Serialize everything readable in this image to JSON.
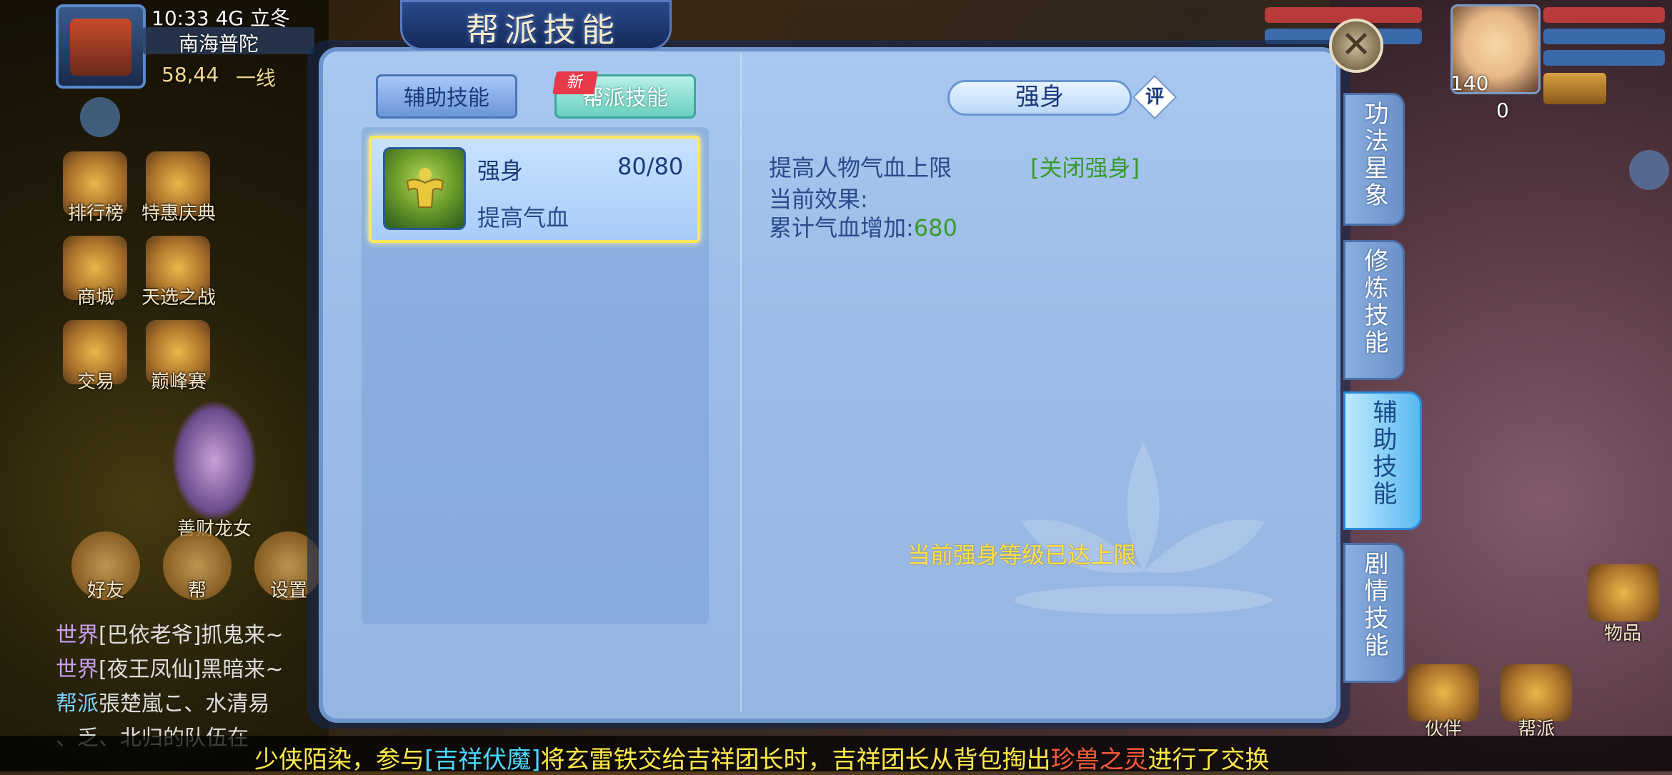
{
  "hud": {
    "time_signal_term": "10:33 4G 立冬",
    "location": "南海普陀",
    "coords": "58,44",
    "line": "一线",
    "right_level": "140",
    "right_count": "0"
  },
  "left_menu": [
    {
      "label": "排行榜",
      "icon": "ranking-icon"
    },
    {
      "label": "特惠庆典",
      "icon": "celebration-icon"
    },
    {
      "label": "商城",
      "icon": "shop-icon"
    },
    {
      "label": "天选之战",
      "icon": "battle-icon"
    },
    {
      "label": "交易",
      "icon": "trade-icon"
    },
    {
      "label": "巅峰赛",
      "icon": "peak-icon"
    }
  ],
  "npc_name": "善财龙女",
  "bottom_buttons": {
    "friends": "好友",
    "guild": "帮",
    "settings": "设置"
  },
  "chat": [
    {
      "channel": "世界",
      "text": "[巴依老爷]抓鬼来~"
    },
    {
      "channel": "世界",
      "text": "[夜王凤仙]黑暗来~"
    },
    {
      "channel": "帮派",
      "text": "張楚嵐こ、水清易"
    },
    {
      "channel": "",
      "text": "、乏、北归的队伍在"
    }
  ],
  "right_hud": {
    "items_label": "物品",
    "partner_label": "伙伴",
    "guild_label": "帮派"
  },
  "panel": {
    "title": "帮派技能",
    "close_icon": "close-icon",
    "tabs": {
      "aux": "辅助技能",
      "guild": "帮派技能",
      "new_badge": "新"
    },
    "skill": {
      "name": "强身",
      "level": "80/80",
      "desc": "提高气血"
    },
    "detail": {
      "title": "强身",
      "eval": "评",
      "line1": "提高人物气血上限",
      "line2": "当前效果:",
      "line3_label": "累计气血增加:",
      "line3_value": "680",
      "toggle": "[关闭强身]",
      "status": "当前强身等级已达上限"
    },
    "side_tabs": [
      {
        "label": "功法星象",
        "active": false
      },
      {
        "label": "修炼技能",
        "active": false
      },
      {
        "label": "辅助技能",
        "active": true
      },
      {
        "label": "剧情技能",
        "active": false
      }
    ]
  },
  "ticker": {
    "p1": "少侠陌染，参与",
    "link": "[吉祥伏魔]",
    "p2": "将玄雷铁交给吉祥团长时，吉祥团长从背包掏出",
    "red": "珍兽之灵",
    "p3": "进行了交换"
  },
  "colors": {
    "panel": "#9dbde8",
    "highlight": "#ffe85a",
    "green": "#3a9a2a",
    "status": "#ffe04a"
  }
}
